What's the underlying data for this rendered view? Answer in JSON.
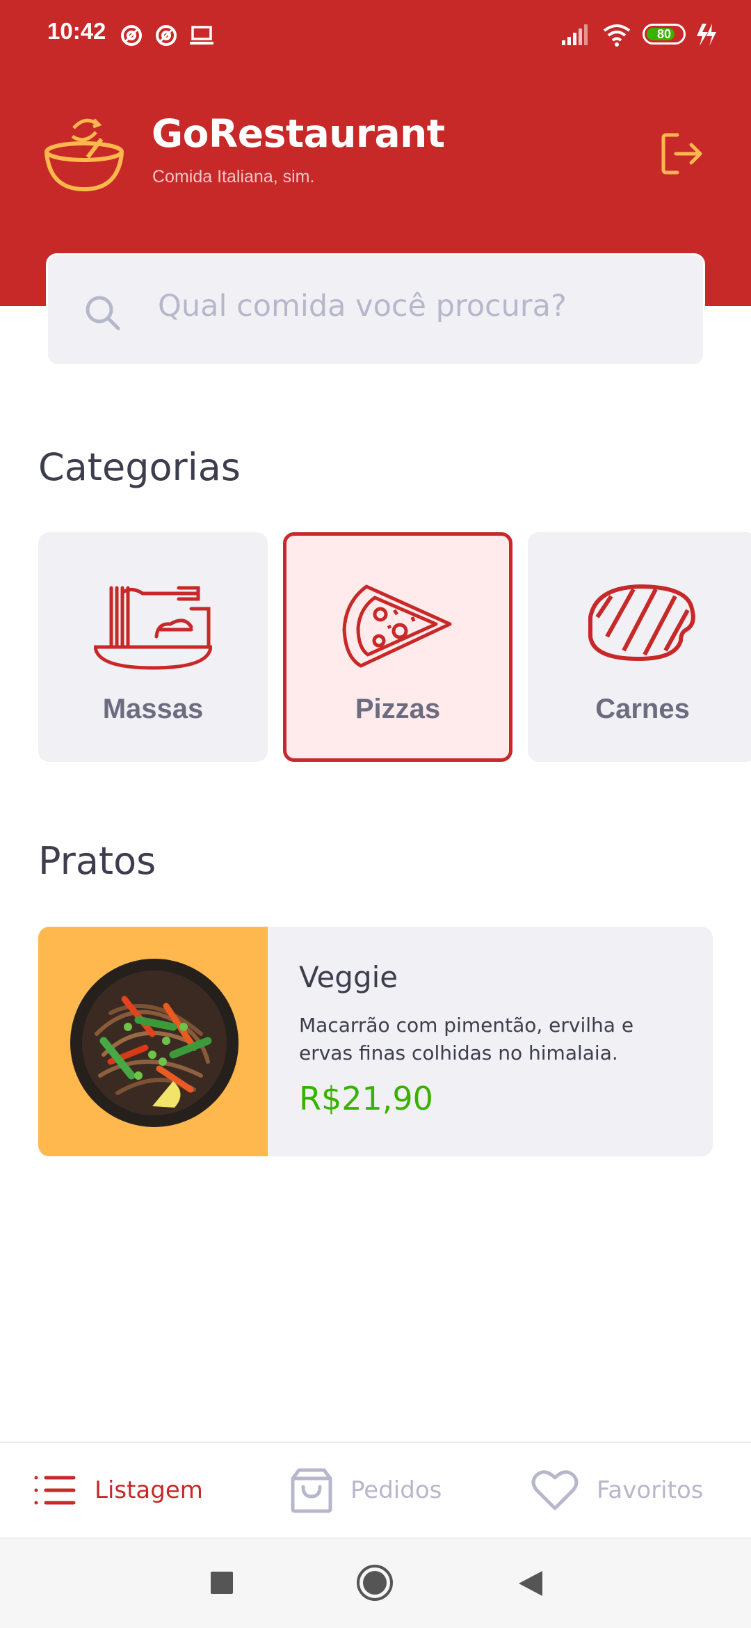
{
  "status_bar": {
    "time": "10:42",
    "battery": "80",
    "battery_level": 0.8,
    "icons": [
      "at-icon",
      "at-icon",
      "laptop-icon",
      "signal-icon",
      "wifi-icon",
      "battery-icon",
      "charging-icon"
    ]
  },
  "header": {
    "title": "GoRestaurant",
    "subtitle": "Comida Italiana, sim.",
    "logo_icon": "bowl-logo-icon",
    "logout_icon": "logout-icon"
  },
  "search": {
    "placeholder": "Qual comida você procura?"
  },
  "categories": {
    "title": "Categorias",
    "items": [
      {
        "label": "Massas",
        "icon": "pasta-icon",
        "selected": false
      },
      {
        "label": "Pizzas",
        "icon": "pizza-icon",
        "selected": true
      },
      {
        "label": "Carnes",
        "icon": "steak-icon",
        "selected": false
      }
    ]
  },
  "dishes": {
    "title": "Pratos",
    "items": [
      {
        "name": "Veggie",
        "description": "Macarrão com pimentão, ervilha e ervas finas colhidas no himalaia.",
        "price": "R$21,90"
      }
    ]
  },
  "bottom_nav": {
    "items": [
      {
        "label": "Listagem",
        "icon": "list-icon",
        "active": true
      },
      {
        "label": "Pedidos",
        "icon": "shopping-bag-icon",
        "active": false
      },
      {
        "label": "Favoritos",
        "icon": "heart-icon",
        "active": false
      }
    ]
  },
  "colors": {
    "brand_red": "#C72828",
    "accent_yellow": "#FFB84D",
    "price_green": "#39B100",
    "card_bg": "#F0F0F5",
    "text_dark": "#3D3D4D",
    "text_muted": "#B7B7CC"
  }
}
